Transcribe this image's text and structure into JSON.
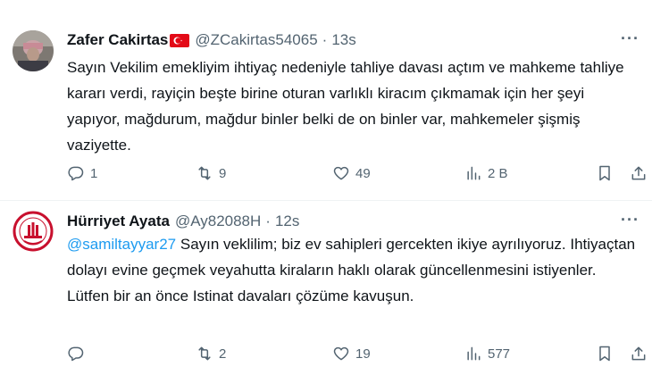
{
  "tweets": [
    {
      "name": "Zafer Cakirtas",
      "handle": "@ZCakirtas54065",
      "separator": "·",
      "time": "13s",
      "mention": "",
      "text": "Sayın Vekilim emekliyim ihtiyaç nedeniyle tahliye davası açtım ve mahkeme tahliye kararı verdi, rayiçin beşte birine oturan varlıklı kiracım çıkmamak için her şeyi yapıyor, mağdurum, mağdur binler belki de on binler var, mahkemeler şişmiş vaziyette.",
      "replies": "1",
      "retweets": "9",
      "likes": "49",
      "views": "2 B",
      "icons": [
        "avatar-photo",
        "turkey-flag-icon",
        "more-icon",
        "reply-icon",
        "retweet-icon",
        "like-icon",
        "views-icon",
        "bookmark-icon",
        "share-icon"
      ]
    },
    {
      "name": "Hürriyet Ayata",
      "handle": "@Ay82088H",
      "separator": "·",
      "time": "12s",
      "mention": "@samiltayyar27",
      "text": " Sayın veklilim; biz ev sahipleri gercekten ikiye ayrılıyoruz. Ihtiyaçtan dolayı evine geçmek veyahutta kiraların haklı olarak güncellenmesini istiyenler. Lütfen bir an önce Istinat davaları çözüme kavuşun.",
      "replies": "",
      "retweets": "2",
      "likes": "19",
      "views": "577",
      "icons": [
        "association-logo-avatar",
        "more-icon",
        "reply-icon",
        "retweet-icon",
        "like-icon",
        "views-icon",
        "bookmark-icon",
        "share-icon"
      ]
    }
  ],
  "colors": {
    "text": "#0f1419",
    "secondary": "#536471",
    "link": "#1d9bf0",
    "divider": "#eff3f4",
    "flag_red": "#e30a17"
  }
}
